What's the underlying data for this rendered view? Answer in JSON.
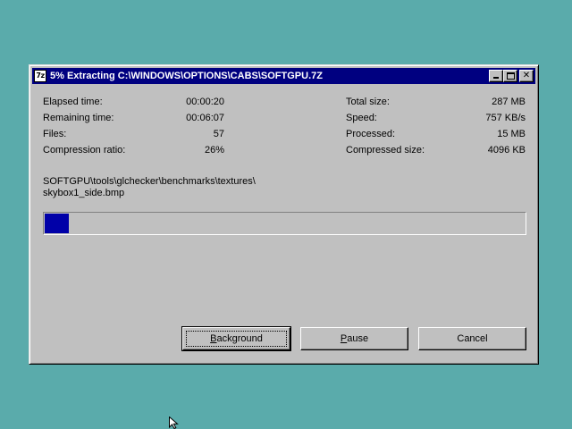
{
  "window": {
    "title": "5% Extracting C:\\WINDOWS\\OPTIONS\\CABS\\SOFTGPU.7Z",
    "app_icon_text": "7z",
    "controls": [
      "minimize-icon",
      "maximize-icon",
      "close-icon"
    ]
  },
  "stats_left": [
    {
      "label": "Elapsed time:",
      "value": "00:00:20"
    },
    {
      "label": "Remaining time:",
      "value": "00:06:07"
    },
    {
      "label": "Files:",
      "value": "57"
    },
    {
      "label": "Compression ratio:",
      "value": "26%"
    }
  ],
  "stats_right": [
    {
      "label": "Total size:",
      "value": "287 MB"
    },
    {
      "label": "Speed:",
      "value": "757 KB/s"
    },
    {
      "label": "Processed:",
      "value": "15 MB"
    },
    {
      "label": "Compressed size:",
      "value": "4096 KB"
    }
  ],
  "current_file": {
    "line1": "SOFTGPU\\tools\\glchecker\\benchmarks\\textures\\",
    "line2": "skybox1_side.bmp"
  },
  "progress": {
    "percent": 5,
    "fill_color": "#0000a8"
  },
  "buttons": {
    "background_mnemonic": "B",
    "background_rest": "ackground",
    "pause_mnemonic": "P",
    "pause_rest": "ause",
    "cancel_label": "Cancel"
  },
  "colors": {
    "desktop": "#5aabab",
    "titlebar": "#000080",
    "window": "#c0c0c0"
  }
}
